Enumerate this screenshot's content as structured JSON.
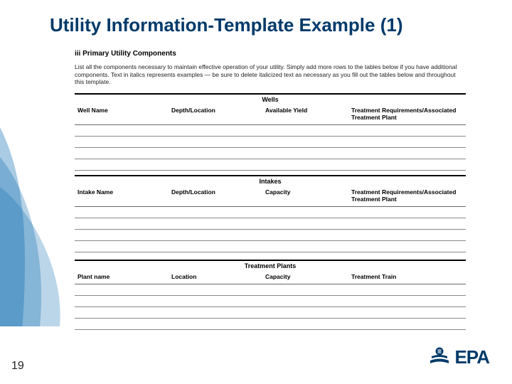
{
  "title": "Utility Information-Template Example (1)",
  "section_num": "iii",
  "section_name": "Primary Utility Components",
  "instruction": "List all the components necessary to maintain effective operation of your utility. Simply add more rows to the tables below if you have additional components. Text in italics represents examples — be sure to delete italicized text as necessary as you fill out the tables below and throughout this template.",
  "tables": [
    {
      "title": "Wells",
      "headers": [
        "Well Name",
        "Depth/Location",
        "Available Yield",
        "Treatment Requirements/Associated Treatment Plant"
      ]
    },
    {
      "title": "Intakes",
      "headers": [
        "Intake Name",
        "Depth/Location",
        "Capacity",
        "Treatment Requirements/Associated Treatment Plant"
      ]
    },
    {
      "title": "Treatment Plants",
      "headers": [
        "Plant name",
        "Location",
        "Capacity",
        "Treatment Train"
      ]
    }
  ],
  "page_number": "19",
  "logo_text": "EPA"
}
